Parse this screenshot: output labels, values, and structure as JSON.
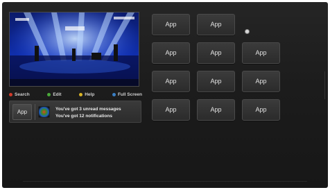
{
  "legend": [
    {
      "label": "Search",
      "color": "#d23a2a",
      "icon": "red-button-icon"
    },
    {
      "label": "Edit",
      "color": "#4aa93a",
      "icon": "green-button-icon"
    },
    {
      "label": "Help",
      "color": "#d9b325",
      "icon": "yellow-button-icon"
    },
    {
      "label": "Full Screen",
      "color": "#3a7fc4",
      "icon": "blue-button-icon"
    }
  ],
  "notifications": {
    "app_label": "App",
    "line1": "You've got 3 unread messages",
    "line2": "You've got 12 notifications"
  },
  "apps": [
    {
      "label": "App"
    },
    {
      "label": "App"
    },
    {
      "label": "App"
    },
    {
      "label": "App"
    },
    {
      "label": "App"
    },
    {
      "label": "App"
    },
    {
      "label": "App"
    },
    {
      "label": "App"
    },
    {
      "label": "App"
    },
    {
      "label": "App"
    },
    {
      "label": "App"
    }
  ]
}
